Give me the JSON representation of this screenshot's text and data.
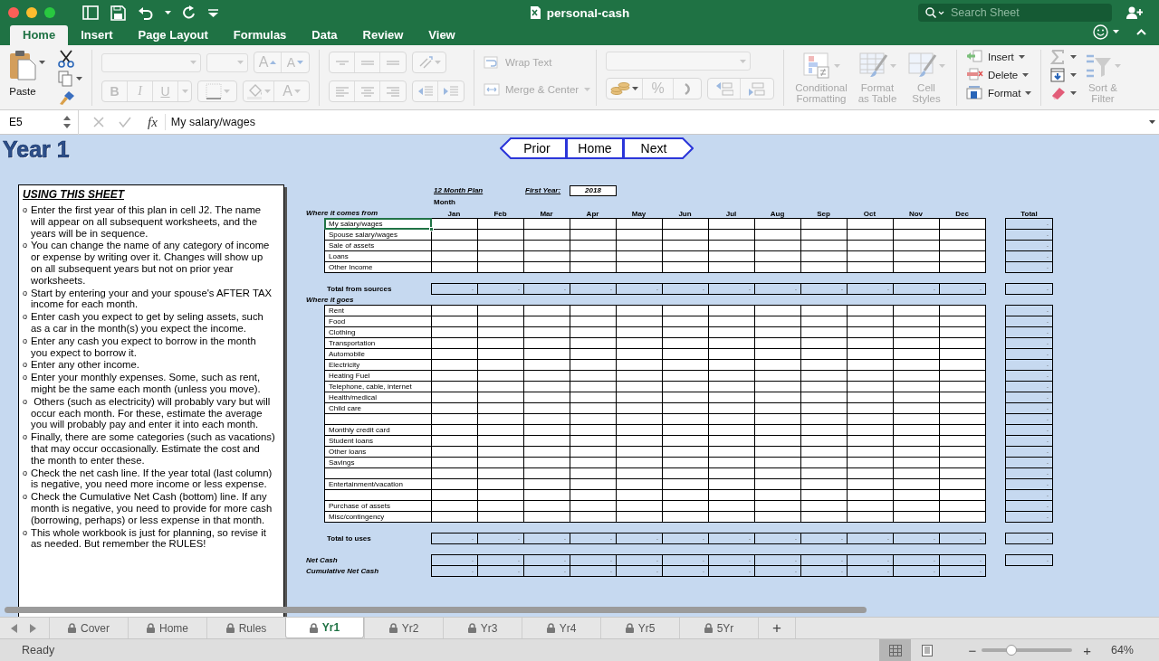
{
  "window": {
    "title": "personal-cash",
    "search": {
      "placeholder": "Search Sheet"
    }
  },
  "ribbon_tabs": [
    {
      "label": "Home",
      "selected": true
    },
    {
      "label": "Insert",
      "selected": false
    },
    {
      "label": "Page Layout",
      "selected": false
    },
    {
      "label": "Formulas",
      "selected": false
    },
    {
      "label": "Data",
      "selected": false
    },
    {
      "label": "Review",
      "selected": false
    },
    {
      "label": "View",
      "selected": false
    }
  ],
  "ribbon": {
    "paste": {
      "label": "Paste"
    },
    "font": {
      "disabled": true,
      "grow": "A",
      "shrink": "A",
      "bold": "B",
      "italic": "I",
      "underline": "U",
      "font_color": "A"
    },
    "number": {
      "disabled": true,
      "percent": "%"
    },
    "alignment": [
      {
        "label": "Wrap Text",
        "kind": "wrap",
        "disabled": true
      },
      {
        "label": "Merge & Center",
        "kind": "merge",
        "disabled": true
      }
    ],
    "styles": [
      {
        "label": "Conditional Formatting",
        "kind": "conditional",
        "disabled": true
      },
      {
        "label": "Format as Table",
        "kind": "table",
        "disabled": true
      },
      {
        "label": "Cell Styles",
        "kind": "styles",
        "disabled": true
      }
    ],
    "cells": [
      {
        "label": "Insert",
        "kind": "insert",
        "disabled": false
      },
      {
        "label": "Delete",
        "kind": "delete",
        "disabled": false
      },
      {
        "label": "Format",
        "kind": "format",
        "disabled": false
      }
    ],
    "sort_filter": {
      "label": "Sort & Filter",
      "disabled": true
    }
  },
  "formula_bar": {
    "cell": "E5",
    "fx": "fx",
    "value": "My salary/wages"
  },
  "sheet": {
    "heading": "Year 1",
    "nav": [
      {
        "label": "Prior",
        "kind": "back"
      },
      {
        "label": "Home",
        "kind": "plain"
      },
      {
        "label": "Next",
        "kind": "forward"
      }
    ],
    "instructions": {
      "title": "USING THIS SHEET",
      "items": [
        {
          "bullet": "o",
          "text": "Enter the first year of this plan in cell J2. The name will appear on all subsequent worksheets, and the years will be in sequence."
        },
        {
          "bullet": "o",
          "text": "You can change the name of any category of income or expense by writing over it. Changes will show up on all subsequent years but not on prior year worksheets."
        },
        {
          "bullet": "o",
          "text": "Start by entering your and your spouse's AFTER TAX income for each month."
        },
        {
          "bullet": "o",
          "text": "Enter cash you expect to get by seling assets, such as a car in the month(s) you expect the income."
        },
        {
          "bullet": "o",
          "text": "Enter any cash you expect to borrow in the month you expect to borrow it."
        },
        {
          "bullet": "o",
          "text": "Enter any other income."
        },
        {
          "bullet": "o",
          "text": "Enter your monthly expenses. Some, such as rent, might be the same each month (unless you move)."
        },
        {
          "bullet": "o",
          "text": " Others (such as electricity) will probably vary but will occur each month. For these, estimate the average you will probably pay and enter it into each month."
        },
        {
          "bullet": "o",
          "text": "Finally, there are some categories (such as vacations) that may occur occasionally. Estimate the cost and the month to enter these."
        },
        {
          "bullet": "o",
          "text": "Check the net cash line. If the year total (last column) is negative, you need more income or less expense."
        },
        {
          "bullet": "o",
          "text": "Check the Cumulative Net Cash (bottom) line. If any month is negative, you need to provide for more cash (borrowing, perhaps) or less expense in that month."
        },
        {
          "bullet": "o",
          "text": "This whole workbook is just for planning, so revise it as needed. But remember the RULES!"
        }
      ]
    },
    "plan": {
      "title": "12 Month Plan",
      "first_year_label": "First Year:",
      "first_year": "2018",
      "month_label": "Month",
      "rows": [
        {
          "kind": "header",
          "label": "Where it comes from",
          "months": [
            "Jan",
            "Feb",
            "Mar",
            "Apr",
            "May",
            "Jun",
            "Jul",
            "Aug",
            "Sep",
            "Oct",
            "Nov",
            "Dec"
          ],
          "total": "Total"
        },
        {
          "kind": "item",
          "label": "My salary/wages",
          "selected": true,
          "total": "-"
        },
        {
          "kind": "item",
          "label": "Spouse salary/wages",
          "selected": false,
          "total": "-"
        },
        {
          "kind": "item",
          "label": "Sale of assets",
          "selected": false,
          "total": "-"
        },
        {
          "kind": "item",
          "label": "Loans",
          "selected": false,
          "total": "-"
        },
        {
          "kind": "item",
          "label": "Other Income",
          "selected": false,
          "total": "-"
        },
        {
          "kind": "spacer"
        },
        {
          "kind": "sum",
          "label": "Total from sources",
          "values": [
            "-",
            "-",
            "-",
            "-",
            "-",
            "-",
            "-",
            "-",
            "-",
            "-",
            "-",
            "-"
          ],
          "total": "-"
        },
        {
          "kind": "section",
          "label": "Where it goes"
        },
        {
          "kind": "item",
          "label": "Rent",
          "selected": false,
          "total": "-"
        },
        {
          "kind": "item",
          "label": "Food",
          "selected": false,
          "total": "-"
        },
        {
          "kind": "item",
          "label": "Clothing",
          "selected": false,
          "total": "-"
        },
        {
          "kind": "item",
          "label": "Transportation",
          "selected": false,
          "total": "-"
        },
        {
          "kind": "item",
          "label": "Automobile",
          "selected": false,
          "total": "-"
        },
        {
          "kind": "item",
          "label": "Electricity",
          "selected": false,
          "total": "-"
        },
        {
          "kind": "item",
          "label": "Heating Fuel",
          "selected": false,
          "total": "-"
        },
        {
          "kind": "item",
          "label": "Telephone, cable, internet",
          "selected": false,
          "total": "-"
        },
        {
          "kind": "item",
          "label": "Health/medical",
          "selected": false,
          "total": "-"
        },
        {
          "kind": "item",
          "label": "Child care",
          "selected": false,
          "total": "-"
        },
        {
          "kind": "blank",
          "selected": false,
          "total": "-"
        },
        {
          "kind": "item",
          "label": "Monthly credit card",
          "selected": false,
          "total": "-"
        },
        {
          "kind": "item",
          "label": "Student loans",
          "selected": false,
          "total": "-"
        },
        {
          "kind": "item",
          "label": "Other loans",
          "selected": false,
          "total": "-"
        },
        {
          "kind": "item",
          "label": "Savings",
          "selected": false,
          "total": "-"
        },
        {
          "kind": "blank",
          "selected": false,
          "total": "-"
        },
        {
          "kind": "item",
          "label": "Entertainment/vacation",
          "selected": false,
          "total": "-"
        },
        {
          "kind": "blank",
          "selected": false,
          "total": "-"
        },
        {
          "kind": "item",
          "label": "Purchase of assets",
          "selected": false,
          "total": "-"
        },
        {
          "kind": "item",
          "label": "Misc/contingency",
          "selected": false,
          "total": "-"
        },
        {
          "kind": "spacer"
        },
        {
          "kind": "sum",
          "label": "Total to uses",
          "values": [
            "-",
            "-",
            "-",
            "-",
            "-",
            "-",
            "-",
            "-",
            "-",
            "-",
            "-",
            "-"
          ],
          "total": "-"
        },
        {
          "kind": "spacer"
        },
        {
          "kind": "net",
          "label": "Net Cash",
          "values": [
            "-",
            "-",
            "-",
            "-",
            "-",
            "-",
            "-",
            "-",
            "-",
            "-",
            "-",
            "-"
          ],
          "total": "-"
        },
        {
          "kind": "net",
          "label": "Cumulative Net Cash",
          "values": [
            "-",
            "-",
            "-",
            "-",
            "-",
            "-",
            "-",
            "-",
            "-",
            "-",
            "-",
            "-"
          ]
        }
      ]
    }
  },
  "sheet_tabs": [
    {
      "label": "Cover",
      "locked": true,
      "selected": false
    },
    {
      "label": "Home",
      "locked": true,
      "selected": false
    },
    {
      "label": "Rules",
      "locked": true,
      "selected": false
    },
    {
      "label": "Yr1",
      "locked": true,
      "selected": true
    },
    {
      "label": "Yr2",
      "locked": true,
      "selected": false
    },
    {
      "label": "Yr3",
      "locked": true,
      "selected": false
    },
    {
      "label": "Yr4",
      "locked": true,
      "selected": false
    },
    {
      "label": "Yr5",
      "locked": true,
      "selected": false
    },
    {
      "label": "5Yr",
      "locked": true,
      "selected": false
    }
  ],
  "add_sheet": "+",
  "status_bar": {
    "status": "Ready",
    "views": [
      {
        "kind": "normal",
        "selected": true
      },
      {
        "kind": "page_layout",
        "selected": false
      }
    ],
    "zoom": {
      "minus": "−",
      "plus": "+",
      "level": 0.33,
      "reading": "64%"
    }
  }
}
